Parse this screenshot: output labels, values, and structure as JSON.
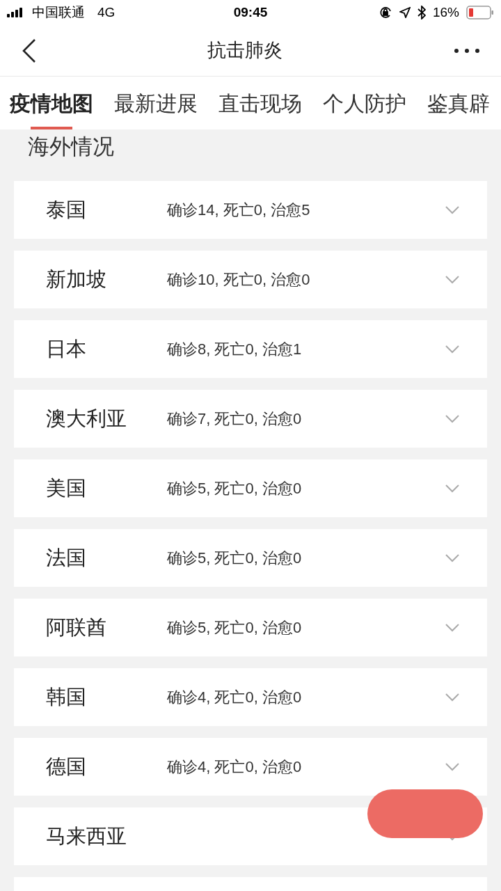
{
  "status_bar": {
    "carrier": "中国联通",
    "network": "4G",
    "time": "09:45",
    "battery": "16%"
  },
  "nav": {
    "title": "抗击肺炎"
  },
  "tabs": [
    {
      "label": "疫情地图",
      "selected": true
    },
    {
      "label": "最新进展",
      "selected": false
    },
    {
      "label": "直击现场",
      "selected": false
    },
    {
      "label": "个人防护",
      "selected": false
    },
    {
      "label": "鉴真辟",
      "selected": false
    }
  ],
  "section_title": "海外情况",
  "countries": [
    {
      "name": "泰国",
      "stats": "确诊14, 死亡0, 治愈5"
    },
    {
      "name": "新加坡",
      "stats": "确诊10, 死亡0, 治愈0"
    },
    {
      "name": "日本",
      "stats": "确诊8, 死亡0, 治愈1"
    },
    {
      "name": "澳大利亚",
      "stats": "确诊7, 死亡0, 治愈0"
    },
    {
      "name": "美国",
      "stats": "确诊5, 死亡0, 治愈0"
    },
    {
      "name": "法国",
      "stats": "确诊5, 死亡0, 治愈0"
    },
    {
      "name": "阿联酋",
      "stats": "确诊5, 死亡0, 治愈0"
    },
    {
      "name": "韩国",
      "stats": "确诊4, 死亡0, 治愈0"
    },
    {
      "name": "德国",
      "stats": "确诊4, 死亡0, 治愈0"
    },
    {
      "name": "马来西亚"
    }
  ]
}
